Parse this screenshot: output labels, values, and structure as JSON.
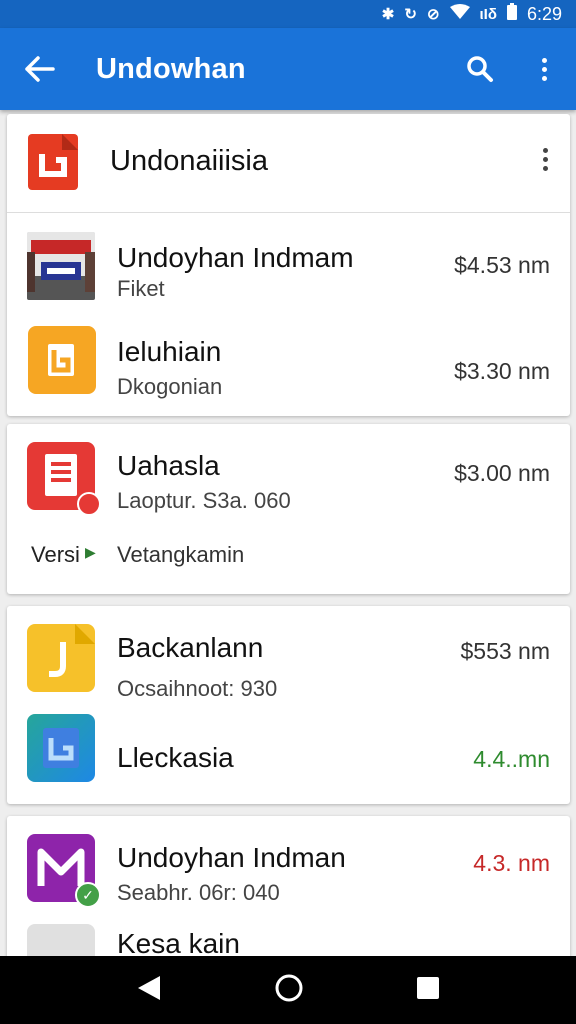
{
  "status_bar": {
    "time": "6:29",
    "signal_text": "ιΙδ",
    "icons": [
      "bluetooth-icon",
      "sync-icon",
      "no-notify-icon",
      "wifi-icon",
      "signal-icon",
      "battery-icon"
    ]
  },
  "app_bar": {
    "title": "Undowhan",
    "icons": [
      "back-arrow-icon",
      "search-icon",
      "overflow-menu-icon"
    ]
  },
  "card1": {
    "header": {
      "title": "Undonaiiisia"
    },
    "items": [
      {
        "title": "Undoyhan Indmam",
        "subtitle": "Fiket",
        "price": "$4.53 nm",
        "price_color": "#333333"
      },
      {
        "title": "Ieluhiain",
        "subtitle": "Dkogonian",
        "price": "$3.30 nm",
        "price_color": "#333333"
      }
    ]
  },
  "card2": {
    "item": {
      "title": "Uahasla",
      "subtitle": "Laoptur. S3a. 060",
      "price": "$3.00 nm",
      "price_color": "#333333"
    },
    "footer": {
      "left": "Versi",
      "right": "Vetangkamin"
    }
  },
  "card3": {
    "items": [
      {
        "title": "Backanlann",
        "subtitle": "Ocsaihnoot: 930",
        "price": "$553 nm",
        "price_color": "#333333"
      },
      {
        "title": "Lleckasia",
        "subtitle": "",
        "price": "4.4..mn",
        "price_color": "#2e8b2e"
      }
    ]
  },
  "card4": {
    "items": [
      {
        "title": "Undoyhan Indman",
        "subtitle": "Seabhr. 06r: 040",
        "price": "4.3. nm",
        "price_color": "#c62828"
      },
      {
        "title": "Kesa kain",
        "subtitle": "",
        "price": "",
        "price_color": "#333333"
      }
    ]
  },
  "colors": {
    "app_bar": "#1a73d9",
    "status_bar": "#1565c0",
    "nav_bar": "#000000"
  }
}
